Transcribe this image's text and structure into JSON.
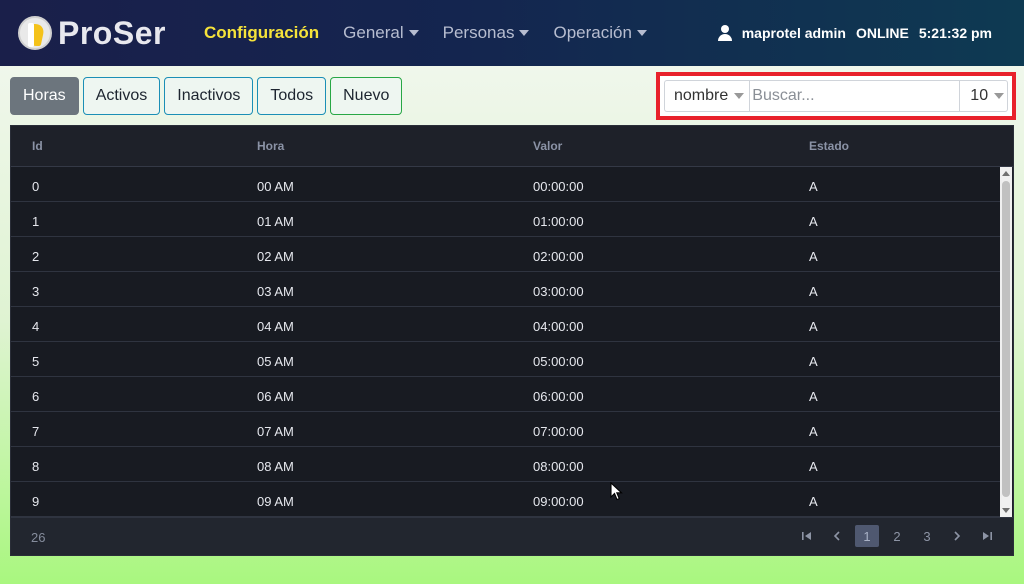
{
  "app": {
    "brand": "ProSer",
    "nav": [
      {
        "label": "Configuración",
        "active": true,
        "dropdown": false
      },
      {
        "label": "General",
        "active": false,
        "dropdown": true
      },
      {
        "label": "Personas",
        "active": false,
        "dropdown": true
      },
      {
        "label": "Operación",
        "active": false,
        "dropdown": true
      }
    ],
    "user": "maprotel admin",
    "status": "ONLINE",
    "time": "5:21:32 pm"
  },
  "toolbar": {
    "buttons": [
      "Horas",
      "Activos",
      "Inactivos",
      "Todos",
      "Nuevo"
    ],
    "selected": "Horas"
  },
  "search": {
    "field": "nombre",
    "placeholder": "Buscar...",
    "page_size": "10"
  },
  "table": {
    "columns": [
      "Id",
      "Hora",
      "Valor",
      "Estado"
    ],
    "rows": [
      [
        "0",
        "00 AM",
        "00:00:00",
        "A"
      ],
      [
        "1",
        "01 AM",
        "01:00:00",
        "A"
      ],
      [
        "2",
        "02 AM",
        "02:00:00",
        "A"
      ],
      [
        "3",
        "03 AM",
        "03:00:00",
        "A"
      ],
      [
        "4",
        "04 AM",
        "04:00:00",
        "A"
      ],
      [
        "5",
        "05 AM",
        "05:00:00",
        "A"
      ],
      [
        "6",
        "06 AM",
        "06:00:00",
        "A"
      ],
      [
        "7",
        "07 AM",
        "07:00:00",
        "A"
      ],
      [
        "8",
        "08 AM",
        "08:00:00",
        "A"
      ],
      [
        "9",
        "09 AM",
        "09:00:00",
        "A"
      ]
    ],
    "total": "26",
    "pages": [
      "1",
      "2",
      "3"
    ],
    "current_page": "1"
  },
  "colors": {
    "highlight": "#e8212b",
    "active_nav": "#f6e33a",
    "selected_button": "#6c757d"
  },
  "icons": {
    "first": "first-page-icon",
    "prev": "previous-page-icon",
    "next": "next-page-icon",
    "last": "last-page-icon",
    "user": "user-icon"
  }
}
